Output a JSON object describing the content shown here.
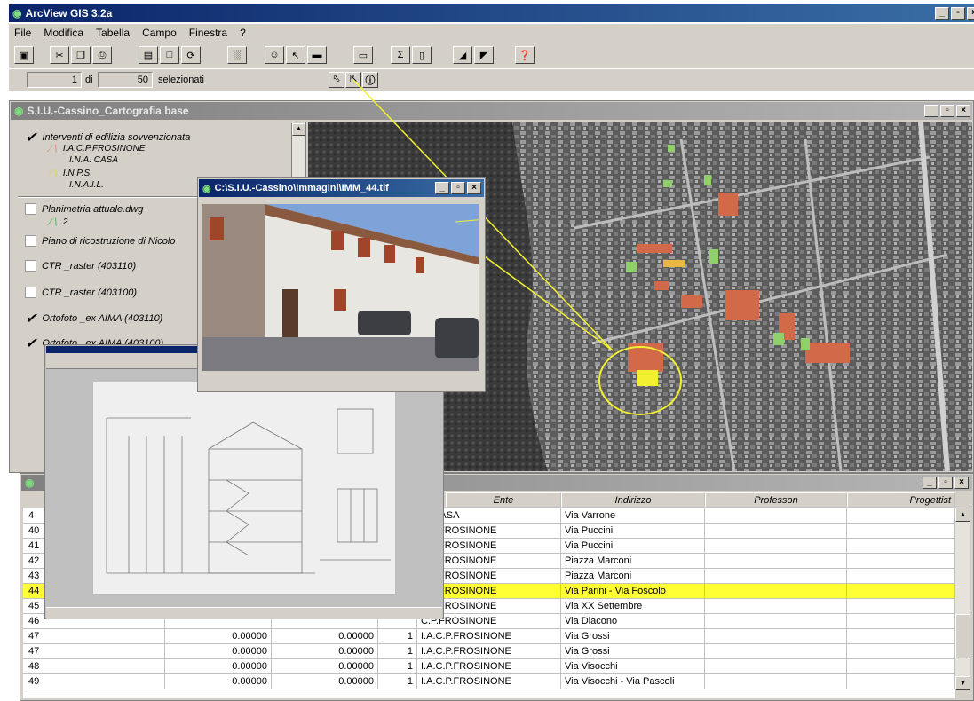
{
  "app": {
    "title": "ArcView GIS 3.2a",
    "menu": [
      "File",
      "Modifica",
      "Tabella",
      "Campo",
      "Finestra",
      "?"
    ],
    "status": {
      "selected": "1",
      "of_label": "di",
      "total": "50",
      "suffix": "selezionati"
    }
  },
  "map_window": {
    "title": "S.I.U.-Cassino_Cartografia base"
  },
  "legend": {
    "items": [
      {
        "label": "Interventi di edilizia sovvenzionata",
        "checked": true
      },
      {
        "label": "I.A.C.P.FROSINONE",
        "sub": true
      },
      {
        "label": "I.N.A. CASA",
        "sub": true
      },
      {
        "label": "I.N.P.S.",
        "sub": true
      },
      {
        "label": "I.N.A.I.L.",
        "sub": true
      },
      {
        "label": "Planimetria attuale.dwg",
        "checked": false
      },
      {
        "label": "2",
        "sub": true
      },
      {
        "label": "Piano di ricostruzione di Nicolo",
        "checked": false
      },
      {
        "label": "CTR _raster (403110)",
        "checked": false
      },
      {
        "label": "CTR _raster (403100)",
        "checked": false
      },
      {
        "label": "Ortofoto _ex AIMA (403110)",
        "checked": true
      },
      {
        "label": "Ortofoto _ex AIMA (403100)",
        "checked": true
      }
    ]
  },
  "photo_window": {
    "title": "C:\\S.I.U.-Cassino\\Immagini\\IMM_44.tif"
  },
  "table": {
    "columns": [
      "Ente",
      "Indirizzo",
      "Professon",
      "Progettist"
    ],
    "rows": [
      {
        "id": "4",
        "ente": "A. CASA",
        "indirizzo": "Via Varrone"
      },
      {
        "id": "40",
        "ente": "C.P.FROSINONE",
        "indirizzo": "Via Puccini"
      },
      {
        "id": "41",
        "ente": "C.P.FROSINONE",
        "indirizzo": "Via Puccini"
      },
      {
        "id": "42",
        "ente": "C.P.FROSINONE",
        "indirizzo": "Piazza Marconi"
      },
      {
        "id": "43",
        "ente": "C.P.FROSINONE",
        "indirizzo": "Piazza Marconi"
      },
      {
        "id": "44",
        "ente": "C.P.FROSINONE",
        "indirizzo": "Via Parini - Via Foscolo",
        "highlight": true
      },
      {
        "id": "45",
        "ente": "C.P.FROSINONE",
        "indirizzo": "Via XX Settembre"
      },
      {
        "id": "46",
        "ente": "C.P.FROSINONE",
        "indirizzo": "Via Diacono"
      },
      {
        "id": "47",
        "v1": "0.00000",
        "v2": "0.00000",
        "n": "1",
        "ente": "I.A.C.P.FROSINONE",
        "indirizzo": "Via Grossi"
      },
      {
        "id": "47",
        "v1": "0.00000",
        "v2": "0.00000",
        "n": "1",
        "ente": "I.A.C.P.FROSINONE",
        "indirizzo": "Via Grossi"
      },
      {
        "id": "48",
        "v1": "0.00000",
        "v2": "0.00000",
        "n": "1",
        "ente": "I.A.C.P.FROSINONE",
        "indirizzo": "Via Visocchi"
      },
      {
        "id": "49",
        "v1": "0.00000",
        "v2": "0.00000",
        "n": "1",
        "ente": "I.A.C.P.FROSINONE",
        "indirizzo": "Via Visocchi - Via Pascoli"
      }
    ]
  }
}
